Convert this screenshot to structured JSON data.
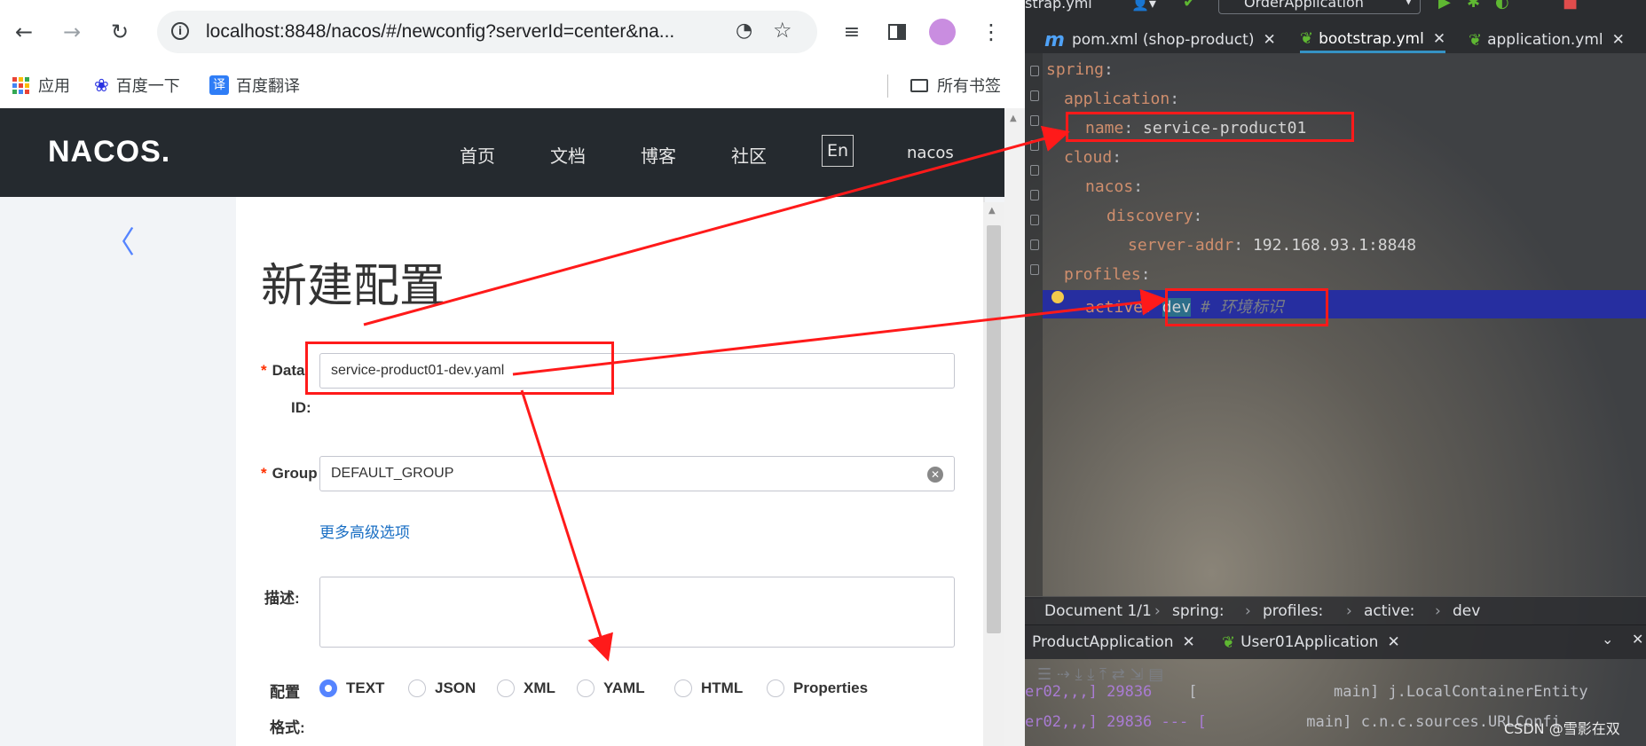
{
  "browser": {
    "url": "localhost:8848/nacos/#/newconfig?serverId=center&na...",
    "bookmarks": [
      "应用",
      "百度一下",
      "百度翻译"
    ],
    "all_bookmarks": "所有书签",
    "translate_icon_text": "译"
  },
  "nacos": {
    "logo": "NACOS.",
    "nav": [
      "首页",
      "文档",
      "博客",
      "社区"
    ],
    "lang_button": "En",
    "user": "nacos",
    "back_arrow": "〈",
    "page_title": "新建配置",
    "data_id_label_1": "Data",
    "data_id_label_2": "ID:",
    "data_id_value": "service-product01-dev.yaml",
    "group_label": "Group",
    "group_value": "DEFAULT_GROUP",
    "advanced_link": "更多高级选项",
    "desc_label": "描述:",
    "format_label_1": "配置",
    "format_label_2": "格式:",
    "formats": [
      "TEXT",
      "JSON",
      "XML",
      "YAML",
      "HTML",
      "Properties"
    ],
    "selected_format": "TEXT",
    "required_mark": "*"
  },
  "ide": {
    "top_left": "strap.yml",
    "run_config": "OrderApplication",
    "tabs": [
      "pom.xml (shop-product)",
      "bootstrap.yml",
      "application.yml"
    ],
    "active_tab": "bootstrap.yml",
    "code": {
      "l1_key": "spring",
      "l2_key": "application",
      "l3_key": "name",
      "l3_val": "service-product01",
      "l4_key": "cloud",
      "l5_key": "nacos",
      "l6_key": "discovery",
      "l7_key": "server-addr",
      "l7_val": "192.168.93.1:8848",
      "l8_key": "profiles",
      "l9_key": "active",
      "l9_val": "dev",
      "l9_comment": "# 环境标识",
      "colon": ":"
    },
    "breadcrumb": [
      "Document 1/1",
      "spring:",
      "profiles:",
      "active:",
      "dev"
    ],
    "run_tabs": [
      "ProductApplication",
      "User01Application"
    ],
    "log_line1_left": "er02,,,] 29836",
    "log_line1_mid": "[",
    "log_line1_right": "main] j.LocalContainerEntity",
    "log_line2_left": "er02,,,] 29836 --- [",
    "log_line2_right": "main] c.n.c.sources.URLConfi",
    "watermark": "CSDN @雪影在双"
  },
  "colors": {
    "nacos_header": "#252a2f",
    "accent_blue": "#5584ff",
    "link_blue": "#1a6fc4",
    "annotation_red": "#ff1a1a",
    "yaml_key": "#cf8e6d"
  }
}
